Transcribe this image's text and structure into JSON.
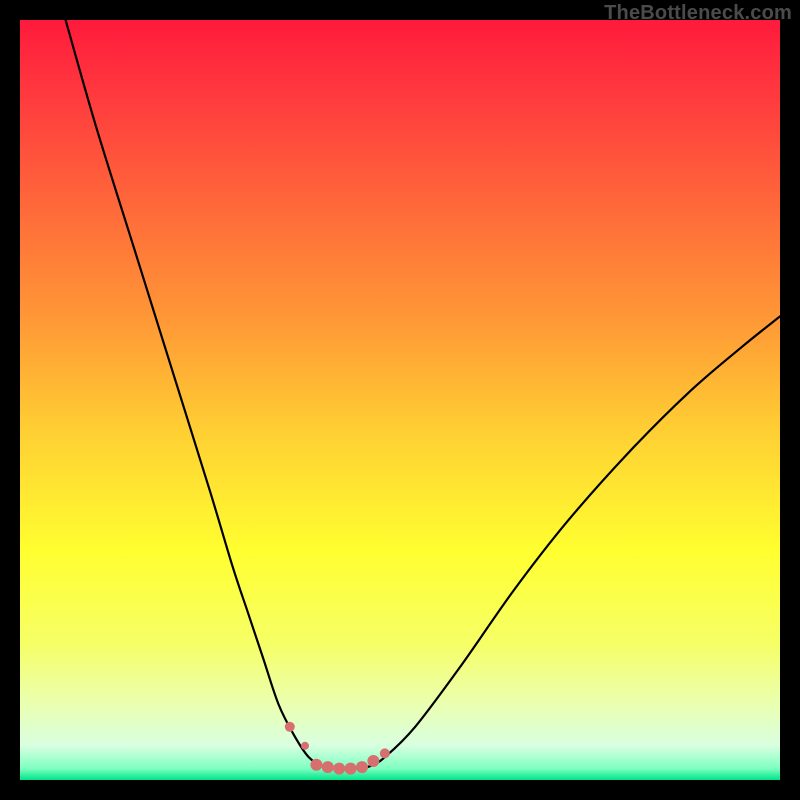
{
  "watermark": {
    "text": "TheBottleneck.com"
  },
  "colors": {
    "frame": "#000000",
    "curve_stroke": "#000000",
    "marker_fill": "#d6706f",
    "gradient_stops": [
      {
        "offset": 0.0,
        "color": "#ff1a3c"
      },
      {
        "offset": 0.1,
        "color": "#ff3a3e"
      },
      {
        "offset": 0.25,
        "color": "#ff6a3a"
      },
      {
        "offset": 0.4,
        "color": "#ff9a36"
      },
      {
        "offset": 0.55,
        "color": "#ffd233"
      },
      {
        "offset": 0.7,
        "color": "#ffff30"
      },
      {
        "offset": 0.82,
        "color": "#f6ff66"
      },
      {
        "offset": 0.9,
        "color": "#eaffb0"
      },
      {
        "offset": 0.955,
        "color": "#d8ffe0"
      },
      {
        "offset": 0.985,
        "color": "#7dffc0"
      },
      {
        "offset": 1.0,
        "color": "#00e38a"
      }
    ]
  },
  "chart_data": {
    "type": "line",
    "title": "",
    "xlabel": "",
    "ylabel": "",
    "xlim": [
      0,
      100
    ],
    "ylim": [
      0,
      100
    ],
    "series": [
      {
        "name": "bottleneck-curve",
        "x": [
          6,
          10,
          15,
          20,
          25,
          28,
          30,
          32,
          34,
          36,
          38,
          40,
          42,
          44,
          46,
          48,
          52,
          58,
          65,
          72,
          80,
          88,
          95,
          100
        ],
        "y": [
          100,
          86,
          70,
          54,
          38,
          28,
          22,
          16,
          10,
          6,
          3,
          1.8,
          1.5,
          1.5,
          1.8,
          3,
          7,
          15,
          25,
          34,
          43,
          51,
          57,
          61
        ]
      }
    ],
    "markers": {
      "name": "valley-markers",
      "x": [
        35.5,
        37.5,
        39.0,
        40.5,
        42.0,
        43.5,
        45.0,
        46.5,
        48.0
      ],
      "y": [
        7.0,
        4.5,
        2.0,
        1.7,
        1.5,
        1.5,
        1.7,
        2.5,
        3.5
      ],
      "size": [
        10,
        8,
        12,
        12,
        12,
        12,
        12,
        12,
        10
      ]
    }
  }
}
